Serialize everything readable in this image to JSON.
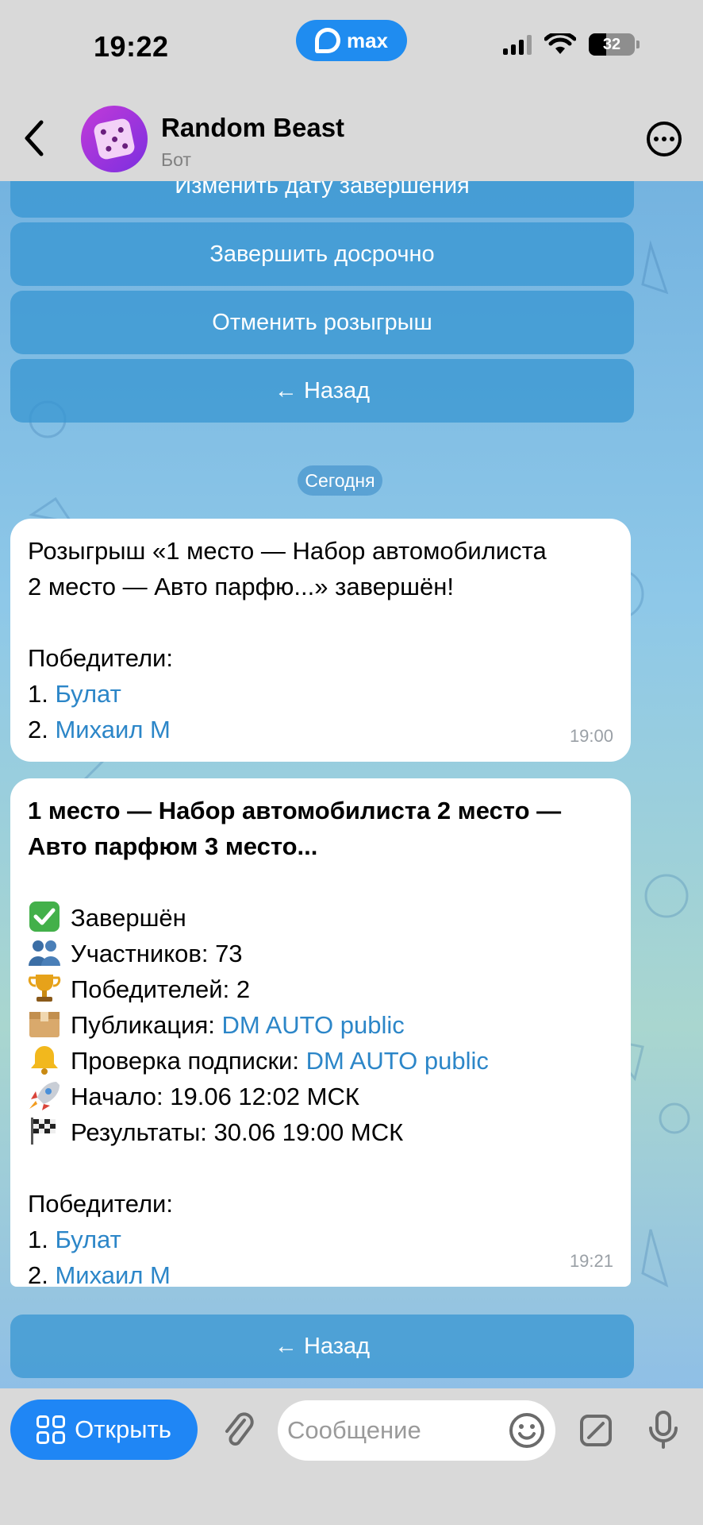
{
  "status_bar": {
    "time": "19:22",
    "app_badge": "max",
    "battery": "32"
  },
  "header": {
    "title": "Random Beast",
    "subtitle": "Бот"
  },
  "keyboard_top": [
    "Изменить дату завершения",
    "Завершить досрочно",
    "Отменить розыгрыш",
    "← Назад"
  ],
  "date_separator": "Сегодня",
  "message1": {
    "line1": "Розыгрыш «1 место — Набор автомобилиста",
    "line2": "2 место — Авто парфю...» завершён!",
    "winners_label": "Победители:",
    "winner1_num": "1.",
    "winner1": "Булат",
    "winner2_num": "2.",
    "winner2": "Михаил М",
    "time": "19:00"
  },
  "message2": {
    "title_line1": "1 место — Набор автомобилиста 2 место —",
    "title_line2": "Авто парфюм 3 место...",
    "status": "Завершён",
    "participants": "Участников: 73",
    "winners_count": "Победителей: 2",
    "publication_label": "Публикация:",
    "publication_link": "DM AUTO public",
    "subscription_label": "Проверка подписки:",
    "subscription_link": "DM AUTO public",
    "start": "Начало: 19.06 12:02 МСК",
    "results": "Результаты: 30.06 19:00 МСК",
    "winners_label": "Победители:",
    "winner1_num": "1.",
    "winner1": "Булат",
    "winner2_num": "2.",
    "winner2": "Михаил М",
    "time": "19:21",
    "emoji_icons": [
      "check-mark-icon",
      "people-icon",
      "trophy-icon",
      "box-icon",
      "bell-icon",
      "rocket-icon",
      "checkered-flag-icon"
    ]
  },
  "keyboard_bottom": {
    "back": "← Назад"
  },
  "input_bar": {
    "open_label": "Открыть",
    "placeholder": "Сообщение"
  },
  "colors": {
    "accent": "#1f86f5",
    "link": "#2c86c8",
    "keyboard_button": "#3796d2"
  }
}
